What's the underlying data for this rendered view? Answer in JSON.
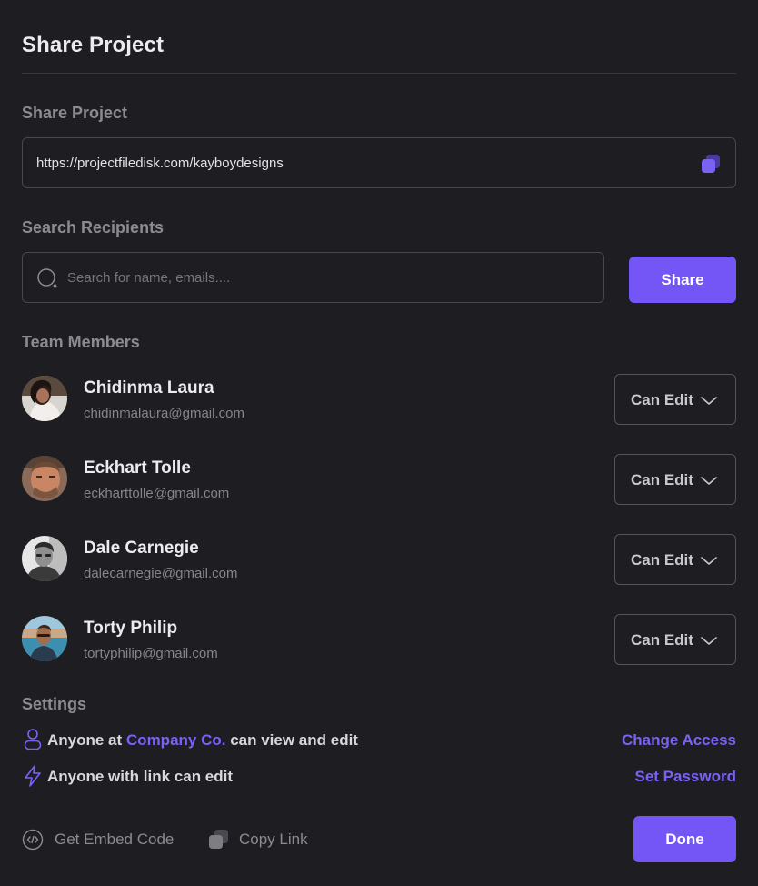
{
  "dialog": {
    "title": "Share Project"
  },
  "share_link": {
    "label": "Share Project",
    "url": "https://projectfiledisk.com/kayboydesigns",
    "copy_icon": "copy-icon"
  },
  "search": {
    "label": "Search Recipients",
    "placeholder": "Search for name, emails....",
    "value": "",
    "icon": "search-icon",
    "share_label": "Share"
  },
  "team": {
    "label": "Team Members",
    "members": [
      {
        "name": "Chidinma Laura",
        "email": "chidinmalaura@gmail.com",
        "role": "Can Edit"
      },
      {
        "name": "Eckhart Tolle",
        "email": "eckharttolle@gmail.com",
        "role": "Can Edit"
      },
      {
        "name": "Dale Carnegie",
        "email": "dalecarnegie@gmail.com",
        "role": "Can Edit"
      },
      {
        "name": "Torty Philip",
        "email": "tortyphilip@gmail.com",
        "role": "Can Edit"
      }
    ]
  },
  "settings": {
    "label": "Settings",
    "company_row": {
      "prefix": "Anyone at ",
      "company": "Company Co.",
      "suffix": " can view and edit",
      "action": "Change Access",
      "icon": "user-icon"
    },
    "link_row": {
      "text": "Anyone with link can edit",
      "action": "Set Password",
      "icon": "lightning-icon"
    }
  },
  "footer": {
    "embed_label": "Get Embed Code",
    "embed_icon": "code-icon",
    "copy_label": "Copy Link",
    "copy_icon": "copy-icon",
    "done_label": "Done"
  },
  "colors": {
    "background": "#1e1d21",
    "accent": "#7356f5",
    "accent_text": "#7b62f7",
    "border": "#48474d",
    "muted_text": "#8c8b91"
  }
}
